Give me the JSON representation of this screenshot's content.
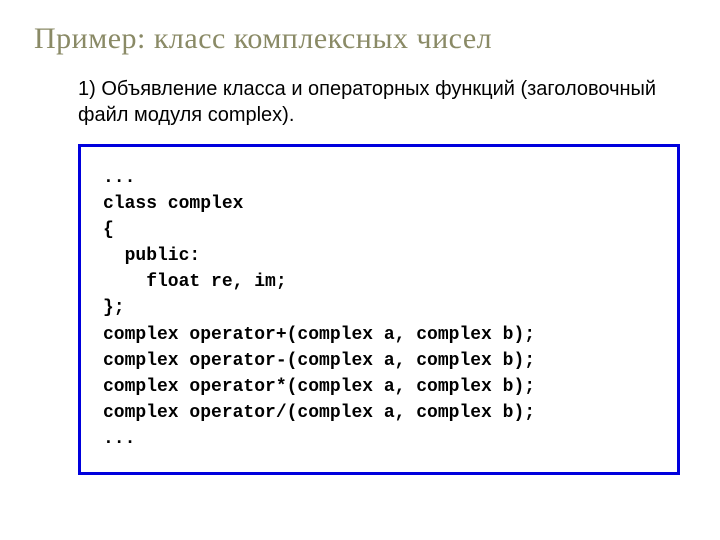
{
  "title": "Пример: класс комплексных чисел",
  "description": "1) Объявление класса и операторных функций (заголовочный файл модуля complex).",
  "code": {
    "l0": "...",
    "l1": "class complex",
    "l2": "{",
    "l3": "  public:",
    "l4": "    float re, im;",
    "l5": "};",
    "l6": "",
    "l7": "complex operator+(complex a, complex b);",
    "l8": "complex operator-(complex a, complex b);",
    "l9": "complex operator*(complex a, complex b);",
    "l10": "complex operator/(complex a, complex b);",
    "l11": "..."
  }
}
